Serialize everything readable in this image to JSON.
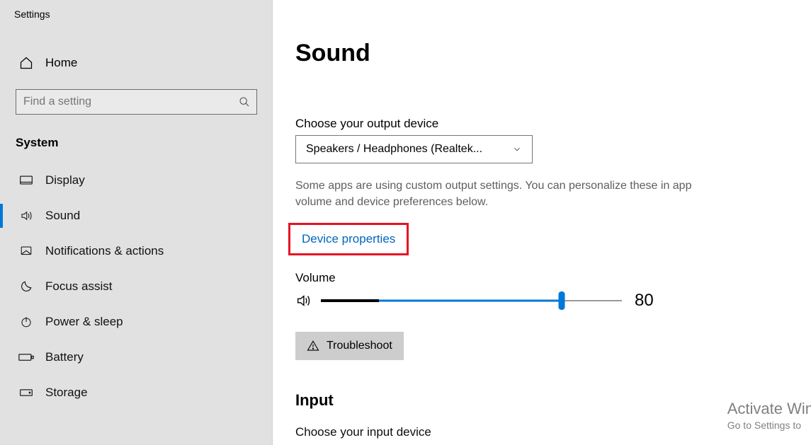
{
  "app_title": "Settings",
  "home_label": "Home",
  "search": {
    "placeholder": "Find a setting"
  },
  "section_label": "System",
  "nav": [
    {
      "label": "Display"
    },
    {
      "label": "Sound"
    },
    {
      "label": "Notifications & actions"
    },
    {
      "label": "Focus assist"
    },
    {
      "label": "Power & sleep"
    },
    {
      "label": "Battery"
    },
    {
      "label": "Storage"
    }
  ],
  "page": {
    "title": "Sound",
    "output_label": "Choose your output device",
    "output_selected": "Speakers / Headphones (Realtek...",
    "hint": "Some apps are using custom output settings. You can personalize these in app volume and device preferences below.",
    "device_properties": "Device properties",
    "volume_label": "Volume",
    "volume_value": "80",
    "troubleshoot_label": "Troubleshoot",
    "input_heading": "Input",
    "input_label": "Choose your input device"
  },
  "watermark": {
    "line1": "Activate Win",
    "line2": "Go to Settings to"
  }
}
